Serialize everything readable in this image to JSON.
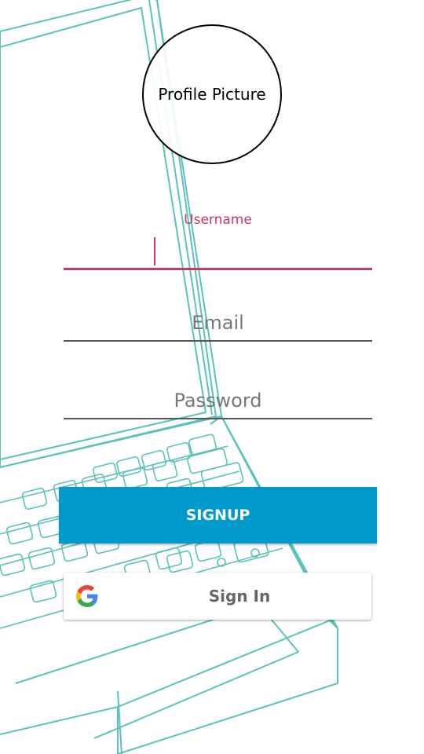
{
  "profile": {
    "label": "Profile Picture"
  },
  "username": {
    "label": "Username",
    "value": ""
  },
  "email": {
    "placeholder": "Email",
    "value": ""
  },
  "password": {
    "placeholder": "Password",
    "value": ""
  },
  "signup": {
    "label": "SIGNUP"
  },
  "google": {
    "label": "Sign In",
    "icon": "google-g-icon"
  },
  "colors": {
    "accent": "#c8385f",
    "signup_button": "#0099cc",
    "background_art": "#3fb8b0",
    "field_underline": "#555555"
  }
}
